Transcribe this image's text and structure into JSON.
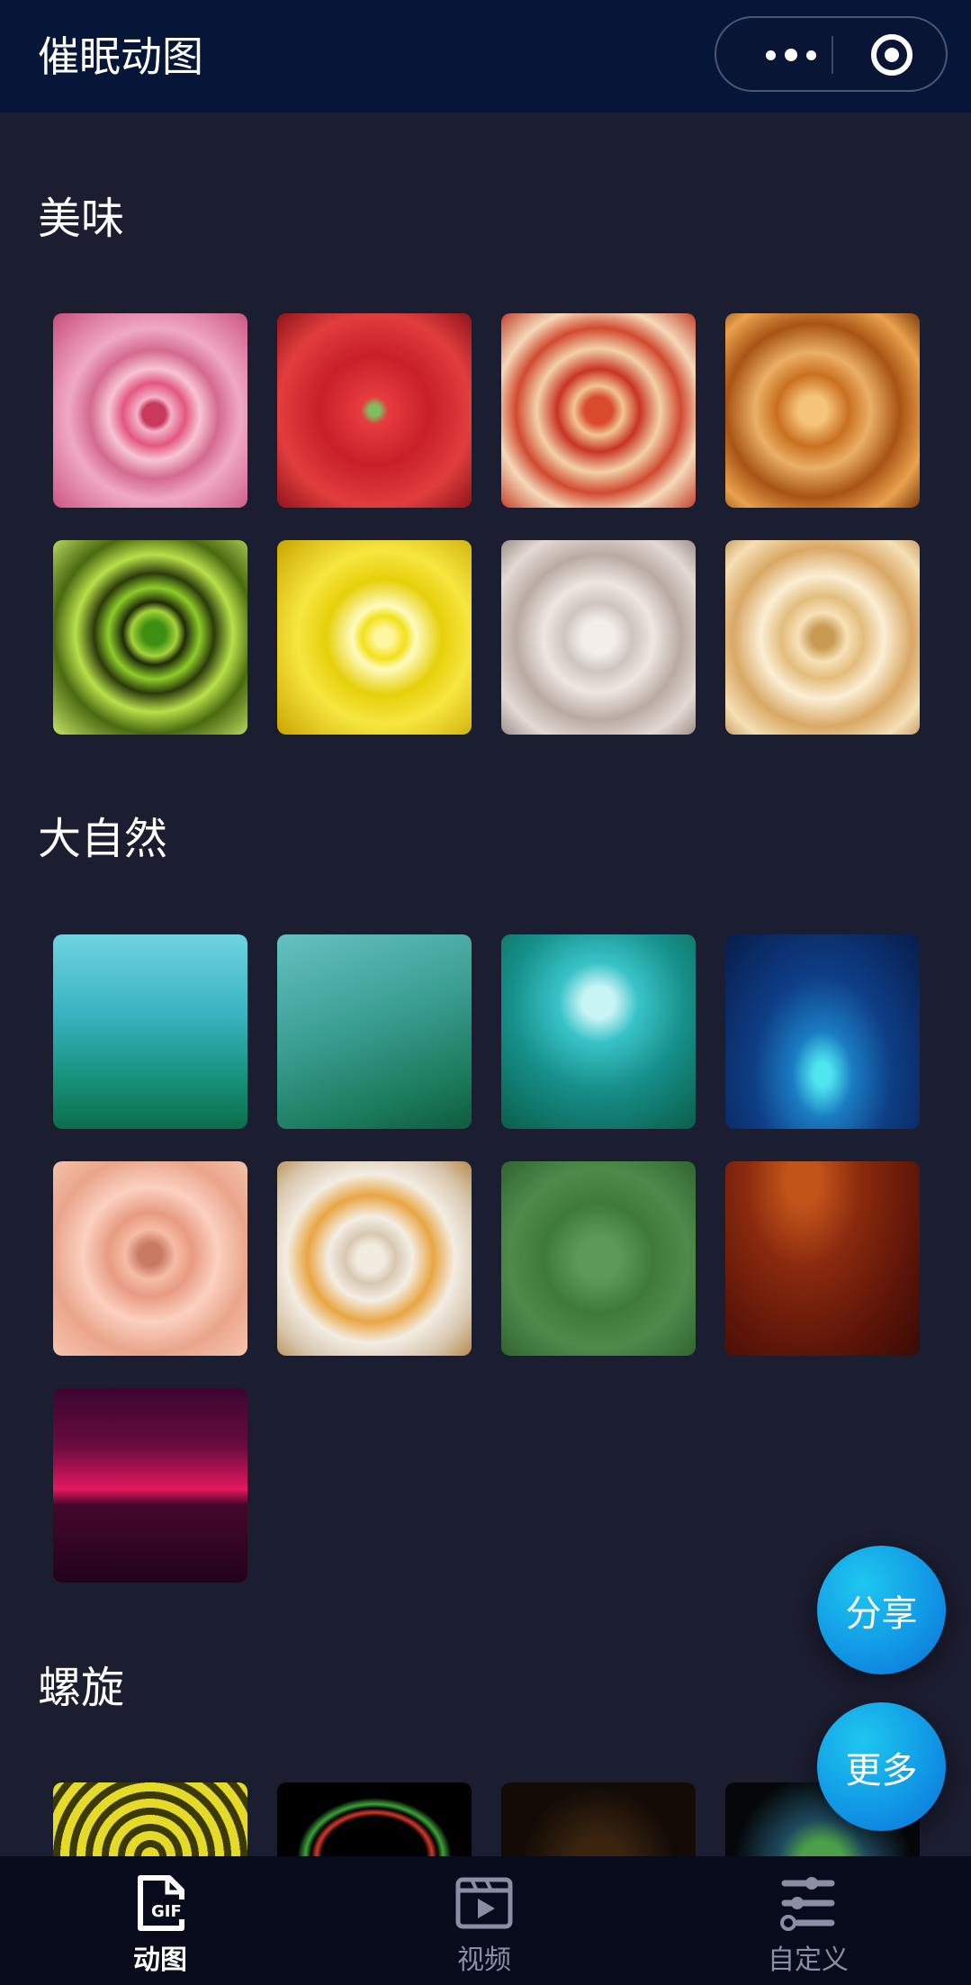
{
  "header": {
    "title": "催眠动图",
    "more_icon": "more-dots-icon",
    "close_icon": "record-target-icon"
  },
  "sections": [
    {
      "title": "美味",
      "items": [
        "donut-spiral",
        "watermelon-spiral",
        "pizza-spiral",
        "pretzel-spiral",
        "kiwi-spiral",
        "lemon-spiral",
        "cauliflower-spiral",
        "popcorn-spiral"
      ]
    },
    {
      "title": "大自然",
      "items": [
        "misty-forest",
        "green-leaves",
        "jungle-portal",
        "ocean-ceiling-fan",
        "peach-rose",
        "white-daisy",
        "green-moss",
        "red-pine-forest",
        "crimson-horizon"
      ]
    },
    {
      "title": "螺旋",
      "items": [
        "yellow-spiral",
        "rainbow-rings",
        "golden-lights",
        "honeycomb-glow"
      ]
    }
  ],
  "fab": {
    "share_label": "分享",
    "more_label": "更多"
  },
  "tabbar": {
    "items": [
      {
        "label": "动图",
        "icon": "gif-file-icon",
        "active": true
      },
      {
        "label": "视频",
        "icon": "video-clapper-icon",
        "active": false
      },
      {
        "label": "自定义",
        "icon": "sliders-icon",
        "active": false
      }
    ]
  },
  "colors": {
    "background": "#1b1d30",
    "header": "#051639",
    "accent": "#1199e6",
    "tab_inactive": "#8a8fa3"
  }
}
